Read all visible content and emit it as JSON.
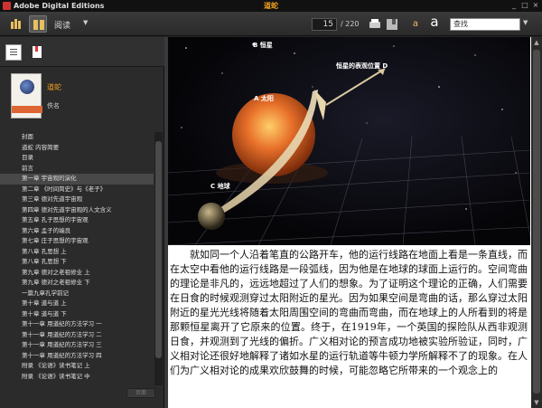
{
  "window": {
    "app_title": "Adobe Digital Editions",
    "doc_title": "道蛇"
  },
  "toolbar": {
    "mode_label": "阅读",
    "page_current": "15",
    "page_total": "/ 220",
    "font_small_label": "a",
    "font_large_label": "a",
    "search_placeholder": "查找"
  },
  "sidebar": {
    "book_title": "道蛇",
    "book_author": "佚名",
    "toc": [
      "封面",
      "道蛇 内容简要",
      "目录",
      "前言",
      "第一章 宇宙观的演化",
      "第二章 《时间简史》与《老子》",
      "第三章 德对先道宇宙观",
      "第四章 德对先道宇宙观的人文含义",
      "第五章 孔子思想的宇宙观",
      "第六章 孟子的端良",
      "第七章 庄子思想的宇宙观",
      "第八章 孔思想 上",
      "第八章 孔思想 下",
      "第九章 德对之老祖修业 上",
      "第九章 德对之老祖修业 下",
      "一篇九章孔学前记",
      "第十章 道与道 上",
      "第十章 道与道 下",
      "第十一章 用道纪的方法学习 一",
      "第十一章 用道纪的方法学习 二",
      "第十一章 用道纪的方法学习 三",
      "第十一章 用道纪的方法学习 四",
      "附录 《论语》读书笔记 上",
      "附录 《论语》读书笔记 中"
    ],
    "active_index": 4,
    "page_button": "页面"
  },
  "figure": {
    "label_b": "B 恒星",
    "label_d": "恒星的表观位置 D",
    "label_a": "A 太阳",
    "label_c": "C 地球"
  },
  "content": {
    "paragraph": "就如同一个人沿着笔直的公路开车，他的运行线路在地面上看是一条直线，而在太空中看他的运行线路是一段弧线，因为他是在地球的球面上运行的。空间弯曲的理论是非凡的，远远地超过了人们的想象。为了证明这个理论的正确，人们需要在日食的时候观测穿过太阳附近的星光。因为如果空间是弯曲的话，那么穿过太阳附近的星光光线将随着太阳周围空间的弯曲而弯曲，而在地球上的人所看到的将是那颗恒星离开了它原来的位置。终于，在1919年，一个英国的探险队从西非观测日食，并观测到了光线的偏折。广义相对论的预言成功地被实验所验证，同时，广义相对论还很好地解释了诸如水星的运行轨道等牛顿力学所解释不了的现象。在人们为广义相对论的成果欢欣鼓舞的时候，可能忽略它所带来的一个观念上的"
  }
}
